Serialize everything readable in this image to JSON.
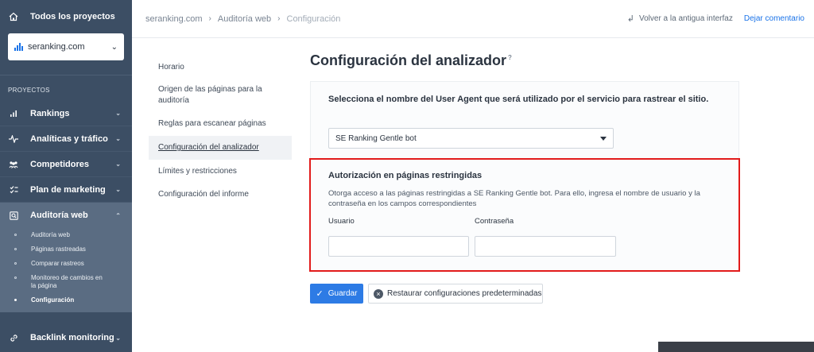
{
  "sidebar": {
    "all_projects": "Todos los proyectos",
    "project_select": "seranking.com",
    "section_label": "PROYECTOS",
    "items": [
      {
        "label": "Rankings",
        "icon": "bar-chart-icon"
      },
      {
        "label": "Analíticas y tráfico",
        "icon": "pulse-icon"
      },
      {
        "label": "Competidores",
        "icon": "users-icon"
      },
      {
        "label": "Plan de marketing",
        "icon": "checklist-icon"
      },
      {
        "label": "Auditoría web",
        "icon": "audit-icon"
      }
    ],
    "subitems": [
      {
        "label": "Auditoría web"
      },
      {
        "label": "Páginas rastreadas"
      },
      {
        "label": "Comparar rastreos"
      },
      {
        "label": "Monitoreo de cambios en la página"
      },
      {
        "label": "Configuración"
      }
    ],
    "bottom_item": {
      "label": "Backlink monitoring",
      "icon": "link-icon"
    }
  },
  "header": {
    "breadcrumb": [
      "seranking.com",
      "Auditoría web",
      "Configuración"
    ],
    "old_interface": "Volver a la antigua interfaz",
    "comment": "Dejar comentario"
  },
  "leftnav": [
    "Horario",
    "Origen de las páginas para la auditoría",
    "Reglas para escanear páginas",
    "Configuración del analizador",
    "Límites y restricciones",
    "Configuración del informe"
  ],
  "main": {
    "title": "Configuración del analizador",
    "help_glyph": "?",
    "ua_description": "Selecciona el nombre del User Agent que será utilizado por el servicio para rastrear el sitio.",
    "ua_selected": "SE Ranking Gentle bot",
    "auth": {
      "heading": "Autorización en páginas restringidas",
      "text": "Otorga acceso a las páginas restringidas a SE Ranking Gentle bot. Para ello, ingresa el nombre de usuario y la contraseña en los campos correspondientes",
      "user_label": "Usuario",
      "user_value": "",
      "pass_label": "Contraseña",
      "pass_value": ""
    },
    "save_label": "Guardar",
    "reset_label": "Restaurar configuraciones predeterminadas"
  },
  "colors": {
    "sidebar_bg": "#3c4e64",
    "sidebar_active": "#5a6c82",
    "accent": "#2d7be5",
    "highlight_border": "#e21b1b"
  }
}
